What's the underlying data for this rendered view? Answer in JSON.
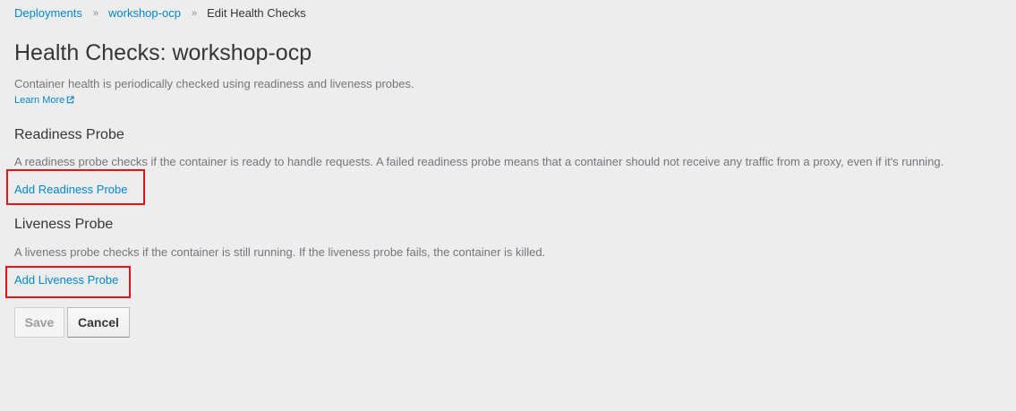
{
  "breadcrumb": {
    "items": [
      {
        "label": "Deployments"
      },
      {
        "label": "workshop-ocp"
      }
    ],
    "current": "Edit Health Checks"
  },
  "page": {
    "title": "Health Checks: workshop-ocp",
    "intro": "Container health is periodically checked using readiness and liveness probes.",
    "learn_more": "Learn More"
  },
  "readiness": {
    "title": "Readiness Probe",
    "description": "A readiness probe checks if the container is ready to handle requests. A failed readiness probe means that a container should not receive any traffic from a proxy, even if it's running.",
    "add_label": "Add Readiness Probe"
  },
  "liveness": {
    "title": "Liveness Probe",
    "description": "A liveness probe checks if the container is still running. If the liveness probe fails, the container is killed.",
    "add_label": "Add Liveness Probe"
  },
  "actions": {
    "save_label": "Save",
    "save_disabled": true,
    "cancel_label": "Cancel"
  },
  "icons": {
    "breadcrumb_separator": "double-chevron-right-icon",
    "learn_more": "external-link-icon"
  },
  "colors": {
    "background": "#ededed",
    "link": "#0088ce",
    "text": "#363636",
    "muted_text": "#72767b",
    "highlight": "#e5131c"
  }
}
